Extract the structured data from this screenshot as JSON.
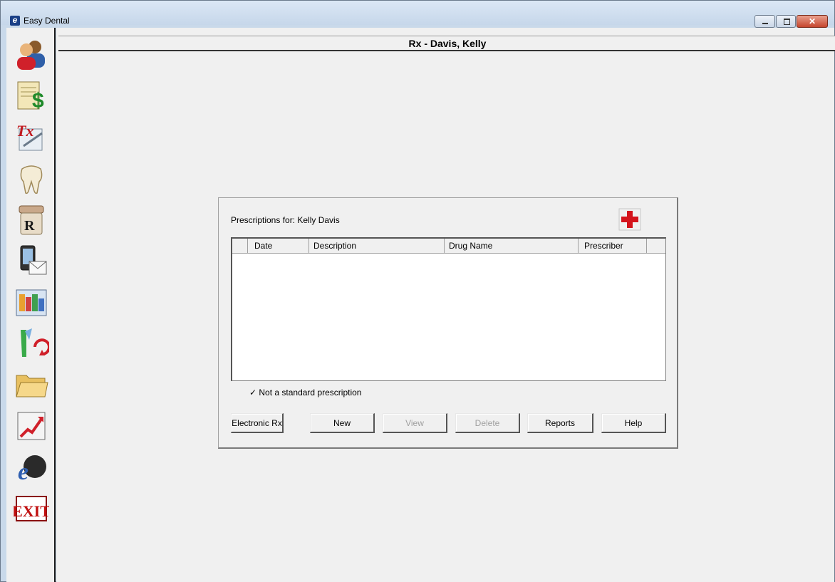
{
  "window": {
    "app_title": "Easy Dental",
    "logo_letter": "e"
  },
  "sidebar": {
    "items": [
      {
        "icon": "family-icon"
      },
      {
        "icon": "ledger-icon"
      },
      {
        "icon": "treatment-plan-icon"
      },
      {
        "icon": "tooth-icon"
      },
      {
        "icon": "prescription-bottle-icon"
      },
      {
        "icon": "contact-manager-icon"
      },
      {
        "icon": "appointment-book-icon"
      },
      {
        "icon": "perio-icon"
      },
      {
        "icon": "document-center-icon"
      },
      {
        "icon": "analysis-icon"
      },
      {
        "icon": "easy-dental-connect-icon"
      },
      {
        "icon": "exit-icon",
        "label": "EXIT"
      }
    ]
  },
  "header": {
    "title": "Rx - Davis, Kelly"
  },
  "panel": {
    "label": "Prescriptions for: Kelly Davis",
    "grid": {
      "columns": [
        "Date",
        "Description",
        "Drug Name",
        "Prescriber"
      ],
      "rows": []
    },
    "legend": "✓ Not a standard prescription",
    "buttons": {
      "electronic_rx": "Electronic Rx",
      "new": "New",
      "view": "View",
      "delete": "Delete",
      "reports": "Reports",
      "help": "Help"
    }
  },
  "colors": {
    "red_cross": "#d4141c",
    "titlebar": "#c9d9ea",
    "background": "#f0f0f0"
  }
}
